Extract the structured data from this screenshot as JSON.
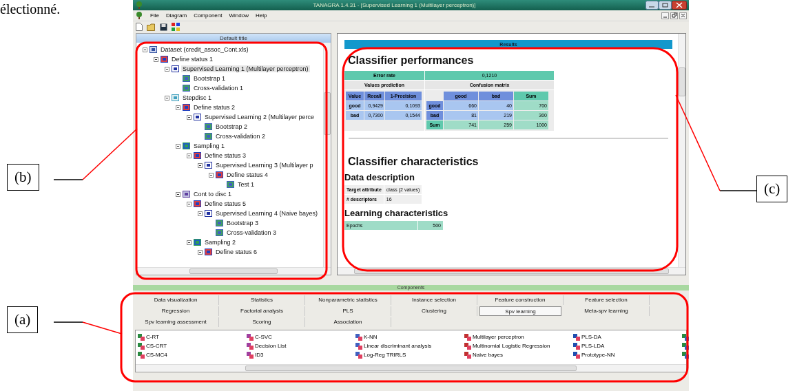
{
  "caption_fragment": "électionné.",
  "window": {
    "title": "TANAGRA 1.4.31 - [Supervised Learning 1 (Multilayer perceptron)]"
  },
  "menu": [
    "File",
    "Diagram",
    "Component",
    "Window",
    "Help"
  ],
  "tree": {
    "title": "Default title",
    "items": [
      {
        "label": "Dataset (credit_assoc_Cont.xls)",
        "kind": "dataset",
        "expanded": true,
        "selected": false,
        "children": [
          {
            "label": "Define status 1",
            "kind": "define",
            "expanded": true,
            "selected": false,
            "children": [
              {
                "label": "Supervised Learning 1 (Multilayer perceptron)",
                "kind": "learner",
                "expanded": true,
                "selected": true,
                "children": [
                  {
                    "label": "Bootstrap 1",
                    "kind": "assess",
                    "selected": false
                  },
                  {
                    "label": "Cross-validation 1",
                    "kind": "assess",
                    "selected": false
                  }
                ]
              },
              {
                "label": "Stepdisc 1",
                "kind": "select",
                "expanded": true,
                "selected": false,
                "children": [
                  {
                    "label": "Define status 2",
                    "kind": "define",
                    "expanded": true,
                    "selected": false,
                    "children": [
                      {
                        "label": "Supervised Learning 2 (Multilayer perce",
                        "kind": "learner",
                        "expanded": true,
                        "selected": false,
                        "children": [
                          {
                            "label": "Bootstrap 2",
                            "kind": "assess",
                            "selected": false
                          },
                          {
                            "label": "Cross-validation 2",
                            "kind": "assess",
                            "selected": false
                          }
                        ]
                      }
                    ]
                  },
                  {
                    "label": "Sampling 1",
                    "kind": "sampling",
                    "expanded": true,
                    "selected": false,
                    "children": [
                      {
                        "label": "Define status 3",
                        "kind": "define",
                        "expanded": true,
                        "selected": false,
                        "children": [
                          {
                            "label": "Supervised Learning 3 (Multilayer p",
                            "kind": "learner",
                            "expanded": true,
                            "selected": false,
                            "children": [
                              {
                                "label": "Define status 4",
                                "kind": "define",
                                "expanded": true,
                                "selected": false,
                                "children": [
                                  {
                                    "label": "Test 1",
                                    "kind": "assess",
                                    "selected": false
                                  }
                                ]
                              }
                            ]
                          }
                        ]
                      }
                    ]
                  },
                  {
                    "label": "Cont to disc 1",
                    "kind": "discretize",
                    "expanded": true,
                    "selected": false,
                    "children": [
                      {
                        "label": "Define status 5",
                        "kind": "define",
                        "expanded": true,
                        "selected": false,
                        "children": [
                          {
                            "label": "Supervised Learning 4 (Naive bayes)",
                            "kind": "learner",
                            "expanded": true,
                            "selected": false,
                            "children": [
                              {
                                "label": "Bootstrap 3",
                                "kind": "assess",
                                "selected": false
                              },
                              {
                                "label": "Cross-validation 3",
                                "kind": "assess",
                                "selected": false
                              }
                            ]
                          }
                        ]
                      },
                      {
                        "label": "Sampling 2",
                        "kind": "sampling",
                        "expanded": true,
                        "selected": false,
                        "children": [
                          {
                            "label": "Define status 6",
                            "kind": "define",
                            "expanded": true,
                            "selected": false
                          }
                        ]
                      }
                    ]
                  }
                ]
              }
            ]
          }
        ]
      }
    ]
  },
  "results": {
    "title": "Results",
    "performance_heading": "Classifier performances",
    "error_rate_label": "Error rate",
    "error_rate": "0,1210",
    "values_title": "Values prediction",
    "confusion_title": "Confusion matrix",
    "values_columns": [
      "Value",
      "Recall",
      "1-Precision"
    ],
    "values_rows": [
      [
        "good",
        "0,9429",
        "0,1093"
      ],
      [
        "bad",
        "0,7300",
        "0,1544"
      ]
    ],
    "confusion_columns": [
      "good",
      "bad",
      "Sum"
    ],
    "confusion_rows": [
      {
        "label": "good",
        "kind": "class",
        "cells": [
          "660",
          "40",
          "700"
        ]
      },
      {
        "label": "bad",
        "kind": "class",
        "cells": [
          "81",
          "219",
          "300"
        ]
      },
      {
        "label": "Sum",
        "kind": "total",
        "cells": [
          "741",
          "259",
          "1000"
        ]
      }
    ],
    "characteristics_heading": "Classifier characteristics",
    "data_heading": "Data description",
    "data_rows": [
      [
        "Target attribute",
        "class (2 values)"
      ],
      [
        "# descriptors",
        "16"
      ]
    ],
    "learning_heading": "Learning characteristics",
    "learning_rows": [
      [
        "Epochs",
        "500"
      ]
    ]
  },
  "components": {
    "title": "Components",
    "tabs": [
      {
        "label": "Data visualization",
        "selected": false
      },
      {
        "label": "Statistics",
        "selected": false
      },
      {
        "label": "Nonparametric statistics",
        "selected": false
      },
      {
        "label": "Instance selection",
        "selected": false
      },
      {
        "label": "Feature construction",
        "selected": false
      },
      {
        "label": "Feature selection",
        "selected": false
      },
      {
        "label": "Regression",
        "selected": false
      },
      {
        "label": "Factorial analysis",
        "selected": false
      },
      {
        "label": "PLS",
        "selected": false
      },
      {
        "label": "Clustering",
        "selected": false
      },
      {
        "label": "Spv learning",
        "selected": true
      },
      {
        "label": "Meta-spv learning",
        "selected": false
      },
      {
        "label": "Spv learning assessment",
        "selected": false
      },
      {
        "label": "Scoring",
        "selected": false
      },
      {
        "label": "Association",
        "selected": false
      }
    ],
    "items": [
      "C-RT",
      "CS-CRT",
      "CS-MC4",
      "C-SVC",
      "Decision List",
      "ID3",
      "K-NN",
      "Linear discriminant analysis",
      "Log-Reg TRIRLS",
      "Multilayer perceptron",
      "Multinomial Logistic Regression",
      "Naive bayes",
      "PLS-DA",
      "PLS-LDA",
      "Prototype-NN"
    ]
  },
  "annotations": [
    {
      "label": "(b)"
    },
    {
      "label": "(a)"
    },
    {
      "label": "(c)"
    }
  ]
}
